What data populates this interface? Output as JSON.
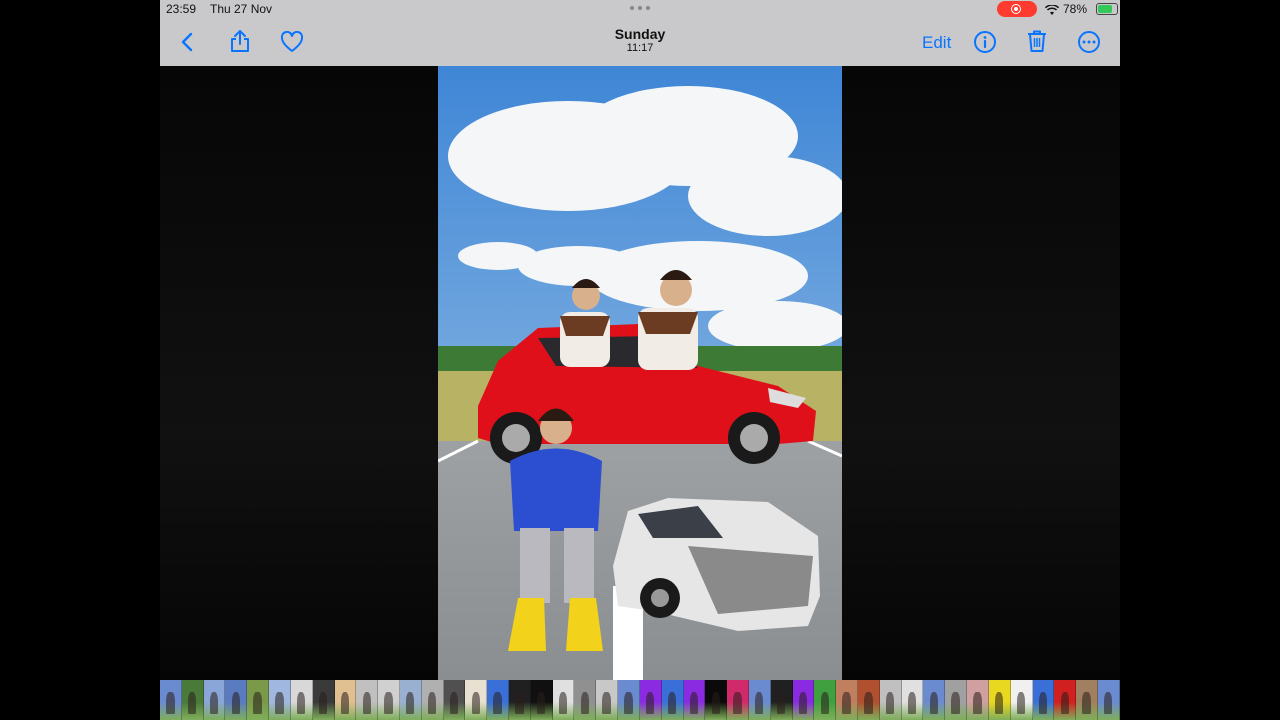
{
  "status_bar": {
    "time": "23:59",
    "date": "Thu 27 Nov",
    "battery": "78%",
    "battery_level": 0.78
  },
  "header": {
    "title": "Sunday",
    "subtitle": "11:17",
    "edit_label": "Edit"
  },
  "icons": {
    "back": "chevron-left-icon",
    "share": "share-icon",
    "favorite": "heart-icon",
    "info": "info-icon",
    "delete": "trash-icon",
    "more": "ellipsis-icon",
    "recording": "screen-record-icon",
    "wifi": "wifi-icon"
  },
  "colors": {
    "accent": "#0a74ff",
    "record": "#ff3b30",
    "toolbar": "#c9c9cb",
    "car_red": "#e0101a",
    "hoodie_blue": "#2b4fd0",
    "boots_yellow": "#f2d21a"
  },
  "photo": {
    "description_icon": "edited-meme-photo"
  },
  "filmstrip": {
    "thumbnails": [
      "#6a8bd0",
      "#4a7a3a",
      "#8aa6d8",
      "#5a7bc0",
      "#7a9a4a",
      "#a0b8e0",
      "#d8d8d8",
      "#3a3a3a",
      "#e0c090",
      "#c0c0c0",
      "#d0d0d0",
      "#9ab0d0",
      "#b0b0b0",
      "#505050",
      "#e8e0d0",
      "#3b6fd8",
      "#202020",
      "#101010",
      "#e0e0e0",
      "#909090",
      "#c8c8c8",
      "#6a8bd0",
      "#8a2be2",
      "#3b6fd8",
      "#8a2be2",
      "#0a0a0a",
      "#d02a6a",
      "#6a8bd0",
      "#202020",
      "#8a2be2",
      "#40a040",
      "#c08060",
      "#b05030",
      "#c0c0c0",
      "#e0e0e0",
      "#6a8bd0",
      "#a0a0a0",
      "#d0a0a0",
      "#e8d820",
      "#f0f0f0",
      "#3b6fd8",
      "#d02020",
      "#a08060",
      "#6a8bd0"
    ]
  }
}
